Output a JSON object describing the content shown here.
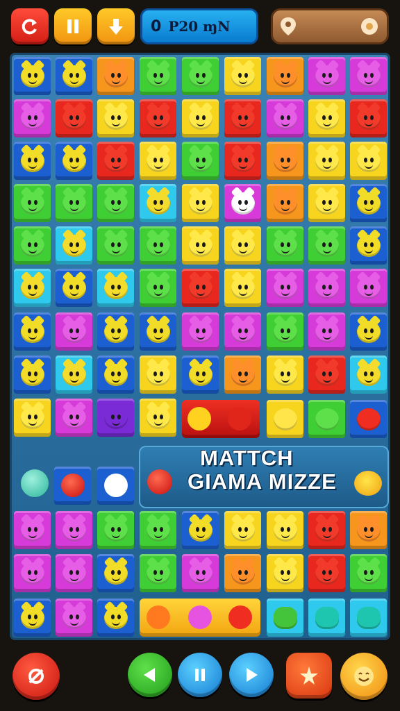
{
  "header": {
    "score_value": "0",
    "score_label": "P20 ɱN"
  },
  "banner": {
    "line1": "MATTCH",
    "line2": "GIAMA MIZZE"
  },
  "icons": {
    "restart": "restart-icon",
    "pause": "pause-icon",
    "download": "download-icon",
    "map_pin": "map-pin-icon",
    "coin": "coin-icon",
    "back": "back-arrow-icon",
    "forward": "forward-arrow-icon",
    "shuffle": "shuffle-icon",
    "boost": "boost-icon",
    "emoji": "emoji-icon"
  },
  "colors": {
    "red": "#e52a24",
    "orange": "#f7a21e",
    "yellow": "#f4d51c",
    "green": "#47c63a",
    "blue": "#1f6fd6",
    "cyan": "#2bc7e8",
    "magenta": "#d43ed8",
    "board": "#2f74a8"
  },
  "tile_colors": {
    "Y": {
      "bg": "#f7d51f",
      "face": "#ffe94a"
    },
    "O": {
      "bg": "#f7961c",
      "face": "#ff8f2a"
    },
    "R": {
      "bg": "#e8271f",
      "face": "#f23a2a"
    },
    "G": {
      "bg": "#3fcf34",
      "face": "#5ee04a"
    },
    "B": {
      "bg": "#1c5fd0",
      "face": "#f1dc28"
    },
    "C": {
      "bg": "#2ec9ec",
      "face": "#f4dc2c"
    },
    "M": {
      "bg": "#d63bd9",
      "face": "#e65ee6"
    },
    "P": {
      "bg": "#7a2bd6",
      "face": "#7a2bd6"
    },
    "W": {
      "bg": "#d73ad8",
      "face": "#ffffff"
    }
  },
  "board": {
    "rows": [
      "BBOGGYOMM",
      "MRYRYRMYR",
      "BBRYGROYY",
      "GGGCYWOYB",
      "GCGGYYGGB",
      "CBCGRYMMM",
      "BMBBMMGMB",
      "BCBYBOYRC",
      "YMPY.....",
      ".........",
      "MMGGBYYRO",
      "MMBGMOYRG",
      "BMB......"
    ]
  }
}
